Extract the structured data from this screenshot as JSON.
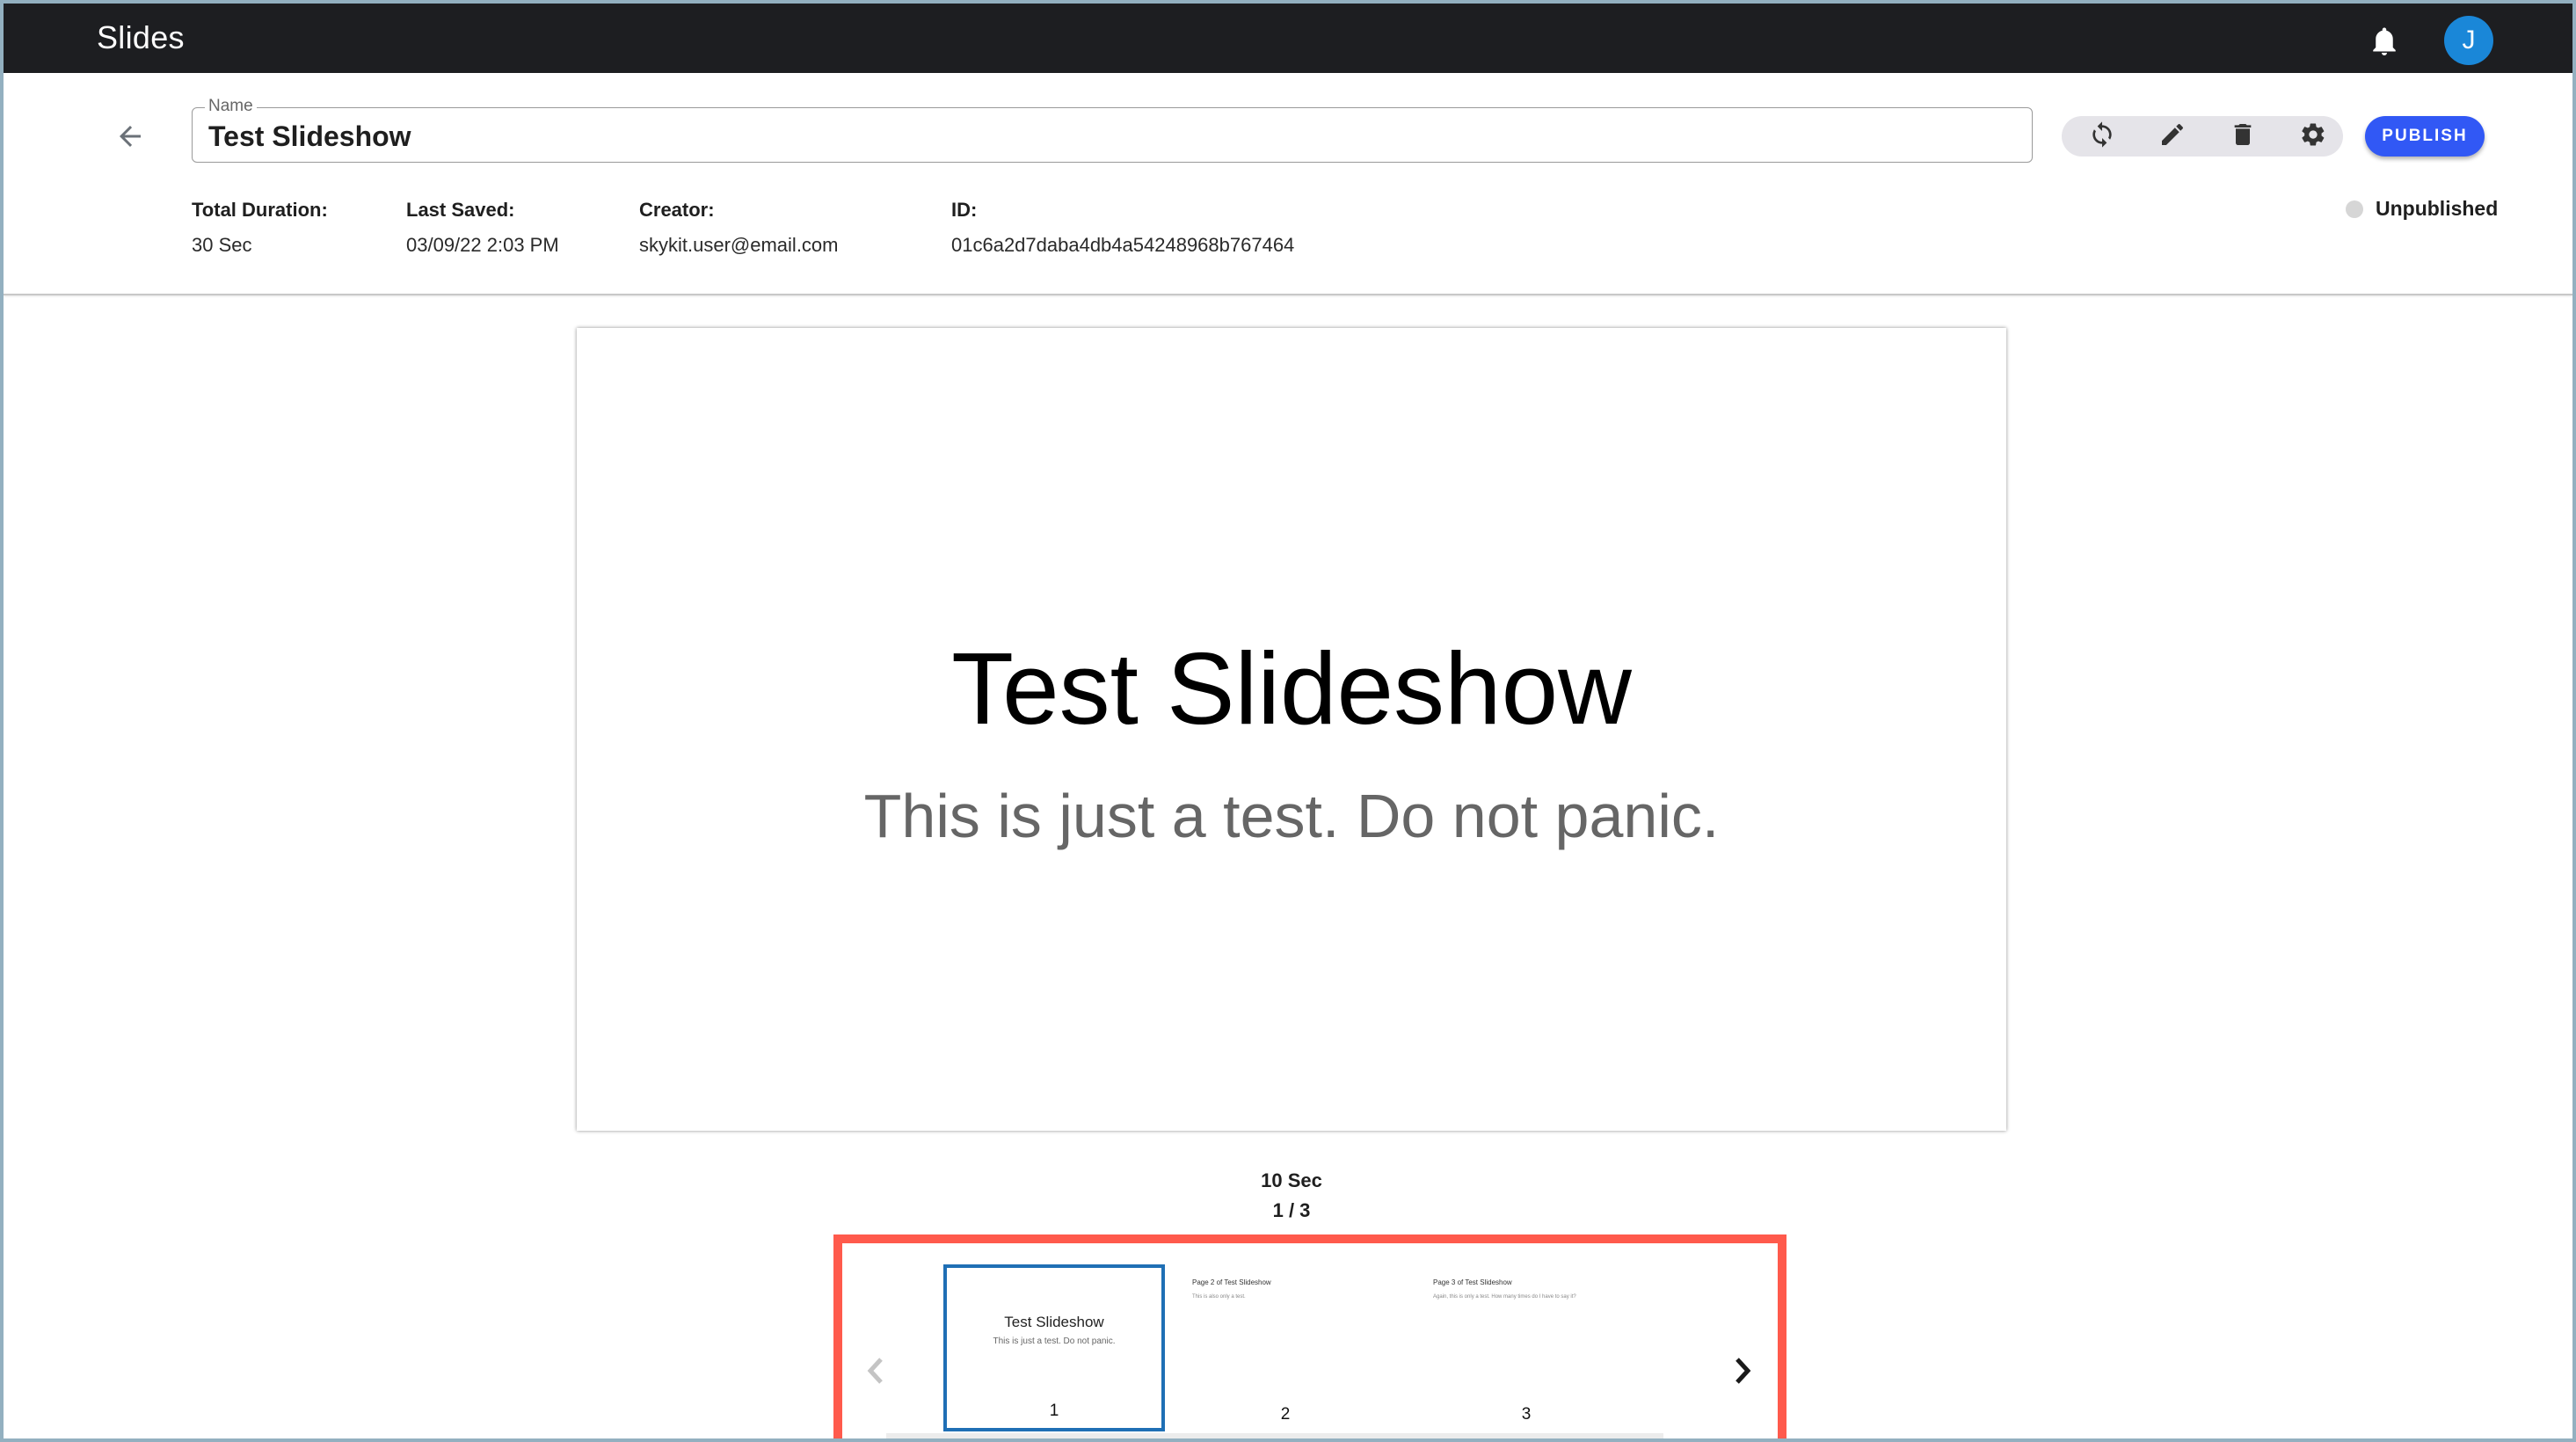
{
  "app": {
    "title": "Slides",
    "avatar_initial": "J",
    "notifications_icon": "bell-icon"
  },
  "header": {
    "back_icon": "arrow-left-icon",
    "name_field": {
      "label": "Name",
      "value": "Test Slideshow"
    },
    "meta": [
      {
        "label": "Total Duration:",
        "value": "30 Sec"
      },
      {
        "label": "Last Saved:",
        "value": "03/09/22 2:03 PM"
      },
      {
        "label": "Creator:",
        "value": "skykit.user@email.com"
      },
      {
        "label": "ID:",
        "value": "01c6a2d7daba4db4a54248968b767464"
      }
    ],
    "toolbar": {
      "icons": [
        "sync-icon",
        "pencil-icon",
        "trash-icon",
        "gear-icon"
      ]
    },
    "publish_label": "PUBLISH",
    "status": {
      "text": "Unpublished",
      "color": "#d6d6d6"
    }
  },
  "preview": {
    "title": "Test Slideshow",
    "subtitle": "This is just a test. Do not panic.",
    "duration": "10 Sec",
    "counter": "1 / 3"
  },
  "thumbnails": {
    "items": [
      {
        "number": "1",
        "title": "Test Slideshow",
        "subtitle": "This is just a test. Do not panic.",
        "selected": true
      },
      {
        "number": "2",
        "title": "Page 2 of Test Slideshow",
        "subtitle": "This is also only a test.",
        "selected": false
      },
      {
        "number": "3",
        "title": "Page 3 of Test Slideshow",
        "subtitle": "Again, this is only a test. How many times do I have to say it?",
        "selected": false
      }
    ]
  },
  "colors": {
    "topbar": "#1d1e21",
    "accent_publish": "#3158f5",
    "avatar": "#1a87d8",
    "selected_thumb": "#1f6fb5",
    "highlight_box": "#ff5a4c",
    "frame": "#93b0c0"
  }
}
